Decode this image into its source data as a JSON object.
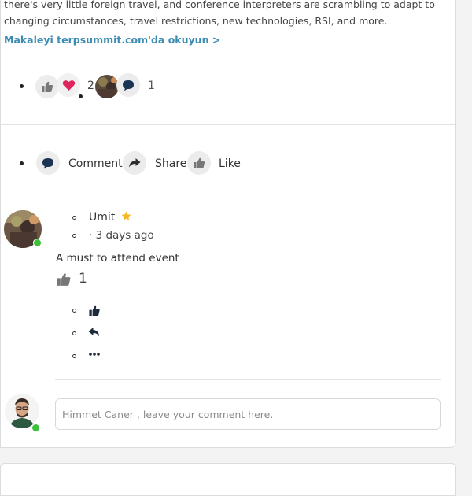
{
  "post": {
    "text_line1": "there's very little foreign travel, and conference interpreters are scrambling to adapt to",
    "text_line2": "changing circumstances, travel restrictions, new technologies, RSI, and more.",
    "read_link": "Makaleyi terpsummit.com'da okuyun >",
    "reaction_count": "2",
    "comment_count": "1"
  },
  "actions": {
    "comment": "Comment",
    "share": "Share",
    "like": "Like"
  },
  "comment": {
    "author": "Umit",
    "time": "· 3 days ago",
    "text": "A must to attend event",
    "like_count": "1"
  },
  "composer": {
    "placeholder": "Himmet Caner , leave your comment here."
  },
  "colors": {
    "link": "#3c8bb3",
    "heart": "#e0245e",
    "online": "#3cc13b",
    "star": "#f5b820"
  },
  "icons": [
    "thumbs-up-icon",
    "heart-icon",
    "chat-bubble-icon",
    "share-arrow-icon",
    "reply-icon",
    "more-icon",
    "star-icon"
  ]
}
